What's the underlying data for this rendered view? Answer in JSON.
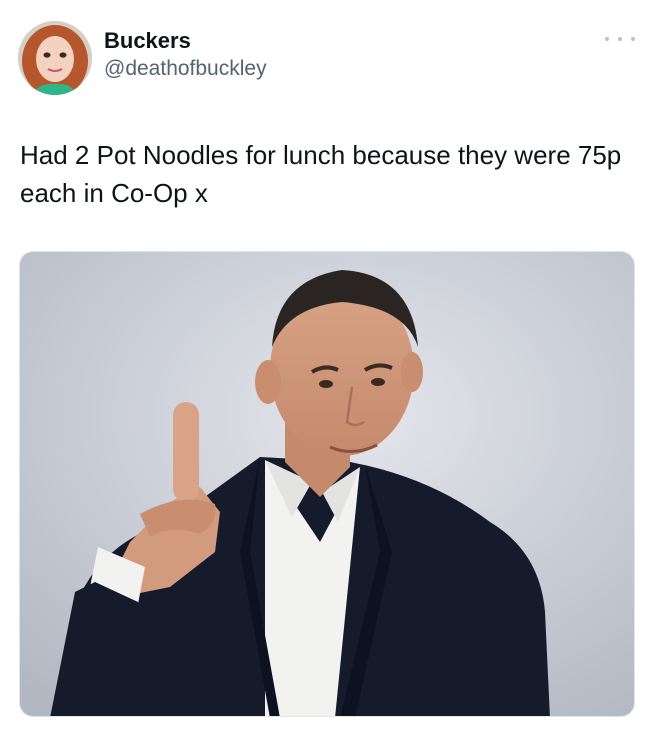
{
  "tweet": {
    "display_name": "Buckers",
    "handle": "@deathofbuckley",
    "text": "Had 2 Pot Noodles for lunch because they were 75p each in Co-Op x",
    "more_icon": "more-horizontal-icon",
    "media": {
      "description_icon": "photo"
    }
  },
  "colors": {
    "text": "#0f1419",
    "secondary": "#536471",
    "photo_background": "#c9cdd6",
    "jacket": "#141a2a"
  }
}
